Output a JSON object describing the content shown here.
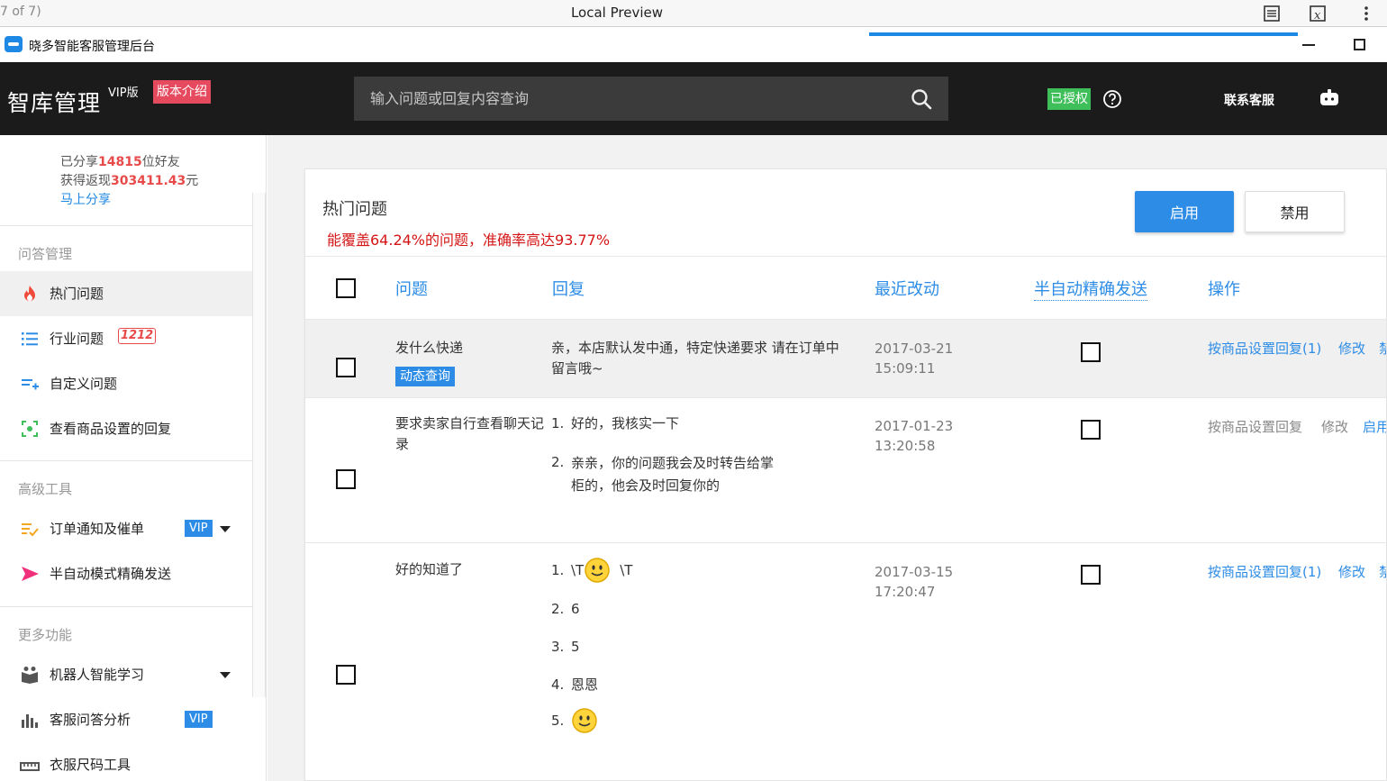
{
  "preview": {
    "pager": "7 of 7)",
    "title": "Local Preview"
  },
  "app": {
    "title": "晓多智能客服管理后台"
  },
  "header": {
    "brand": "智库管理",
    "edition": "VIP版",
    "intro_button": "版本介绍",
    "search_placeholder": "输入问题或回复内容查询",
    "auth_badge": "已授权",
    "contact": "联系客服"
  },
  "sidebar": {
    "share": {
      "prefix1": "已分享",
      "friends": "14815",
      "suffix1": "位好友",
      "prefix2": "获得返现",
      "cash": "303411.43",
      "suffix2": "元",
      "link": "马上分享"
    },
    "sections": [
      {
        "title": "问答管理",
        "items": [
          {
            "label": "热门问题",
            "icon": "flame-icon",
            "active": true
          },
          {
            "label": "行业问题",
            "icon": "list-icon",
            "badge": "1212"
          },
          {
            "label": "自定义问题",
            "icon": "add-list-icon"
          },
          {
            "label": "查看商品设置的回复",
            "icon": "scan-icon"
          }
        ]
      },
      {
        "title": "高级工具",
        "items": [
          {
            "label": "订单通知及催单",
            "icon": "order-check-icon",
            "vip": "VIP"
          },
          {
            "label": "半自动模式精确发送",
            "icon": "send-icon"
          }
        ]
      },
      {
        "title": "更多功能",
        "items": [
          {
            "label": "机器人智能学习",
            "icon": "robot-book-icon"
          },
          {
            "label": "客服问答分析",
            "icon": "bar-chart-icon",
            "vip": "VIP"
          },
          {
            "label": "衣服尺码工具",
            "icon": "ruler-icon"
          }
        ]
      }
    ]
  },
  "main": {
    "title": "热门问题",
    "coverage": "能覆盖64.24%的问题，准确率高达93.77%",
    "enable_button": "启用",
    "disable_button": "禁用",
    "columns": [
      "问题",
      "回复",
      "最近改动",
      "半自动精确发送",
      "操作"
    ],
    "rows": [
      {
        "question": "发什么快递",
        "tag": "动态查询",
        "reply": [
          "亲，本店默认发中通，特定快递要求 请在订单中",
          "留言哦~"
        ],
        "date": "2017-03-21",
        "time": "15:09:11",
        "op1": "按商品设置回复(1)",
        "op2": "修改",
        "op3": "禁"
      },
      {
        "question": "要求卖家自行查看聊天记录",
        "replies": [
          {
            "num": "1.",
            "text": "好的，我核实一下"
          },
          {
            "num": "2.",
            "text": "亲亲，你的问题我会及时转告给掌",
            "text2": "柜的，他会及时回复你的"
          }
        ],
        "date": "2017-01-23",
        "time": "13:20:58",
        "op1": "按商品设置回复",
        "op2": "修改",
        "op3": "启用"
      },
      {
        "question": "好的知道了",
        "replies": [
          {
            "num": "1.",
            "pre": "\\T",
            "post": "\\T"
          },
          {
            "num": "2.",
            "text": "6"
          },
          {
            "num": "3.",
            "text": "5"
          },
          {
            "num": "4.",
            "text": "恩恩"
          },
          {
            "num": "5.",
            "emoji": "smiley-icon"
          }
        ],
        "date": "2017-03-15",
        "time": "17:20:47",
        "op1": "按商品设置回复(1)",
        "op2": "修改",
        "op3": "禁"
      }
    ]
  }
}
